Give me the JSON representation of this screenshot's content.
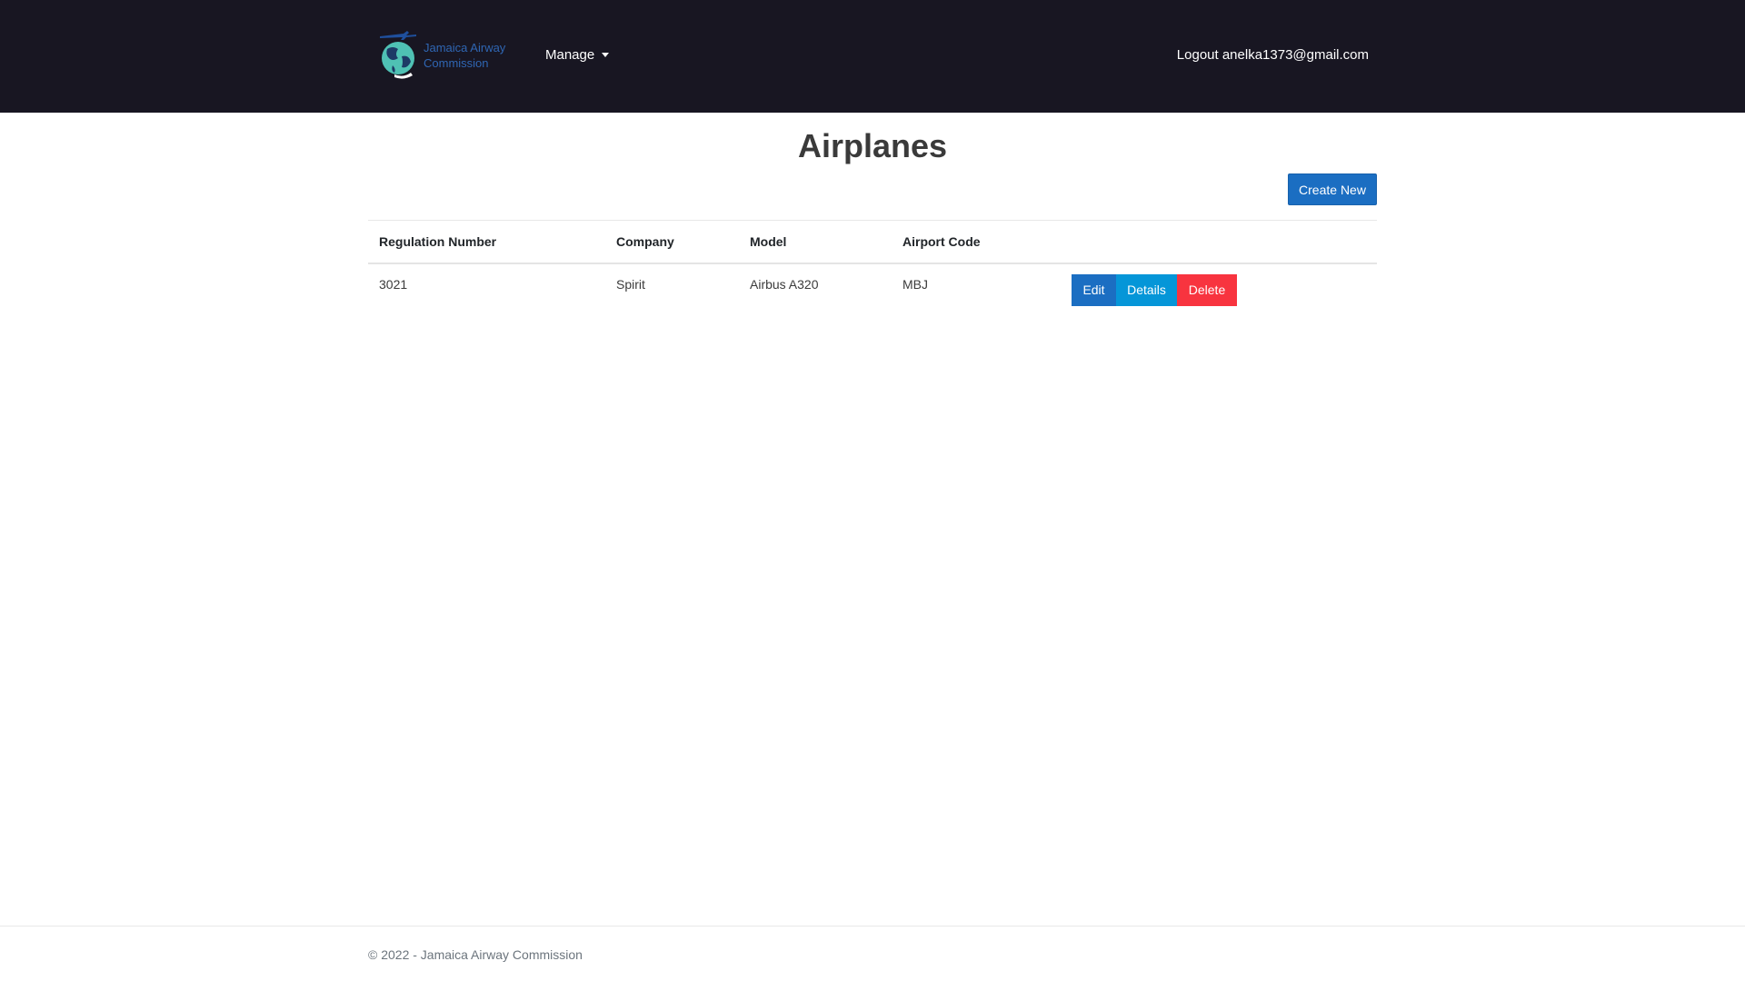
{
  "brand": {
    "name": "Jamaica Airway Commission",
    "logo_icon": "globe-airplane-icon",
    "text_color": "#2f66b3"
  },
  "nav": {
    "manage_label": "Manage",
    "logout_label": "Logout anelka1373@gmail.com",
    "background": "#181622"
  },
  "page": {
    "title": "Airplanes",
    "create_label": "Create New"
  },
  "table": {
    "headers": [
      "Regulation Number",
      "Company",
      "Model",
      "Airport Code"
    ],
    "rows": [
      {
        "regulation_number": "3021",
        "company": "Spirit",
        "model": "Airbus A320",
        "airport_code": "MBJ",
        "actions": {
          "edit": "Edit",
          "details": "Details",
          "delete": "Delete"
        }
      }
    ]
  },
  "colors": {
    "primary": "#1b6ec2",
    "info": "#0596d8",
    "danger": "#f8343f"
  },
  "footer": {
    "text": "© 2022 - Jamaica Airway Commission"
  }
}
